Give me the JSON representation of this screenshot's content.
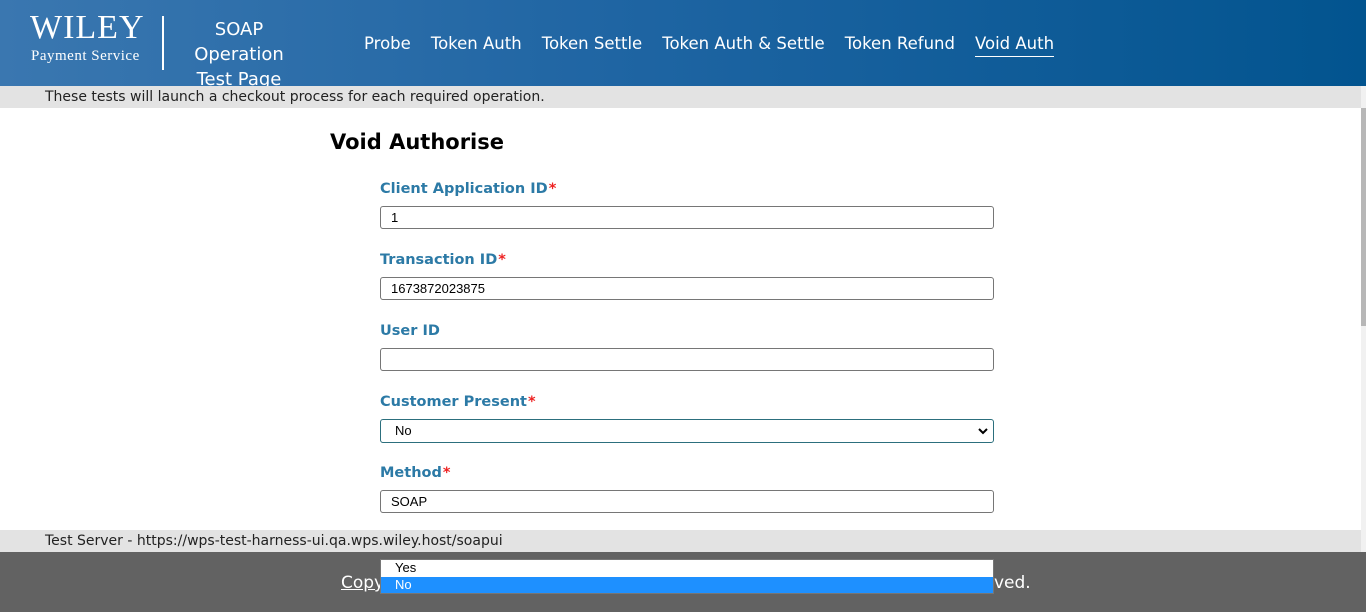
{
  "header": {
    "logo_text": "WILEY",
    "logo_subtitle": "Payment Service",
    "app_title_line1": "SOAP Operation",
    "app_title_line2": "Test Page",
    "nav": [
      {
        "label": "Probe"
      },
      {
        "label": "Token Auth"
      },
      {
        "label": "Token Settle"
      },
      {
        "label": "Token Auth & Settle"
      },
      {
        "label": "Token Refund"
      },
      {
        "label": "Void Auth",
        "active": true
      }
    ]
  },
  "info_bar_text": "These tests will launch a checkout process for each required operation.",
  "form": {
    "title": "Void Authorise",
    "required_marker": "*",
    "fields": [
      {
        "label": "Client Application ID",
        "required": true,
        "value": "1"
      },
      {
        "label": "Transaction ID",
        "required": true,
        "value": "1673872023875"
      },
      {
        "label": "User ID",
        "required": false,
        "value": ""
      },
      {
        "label": "Customer Present",
        "required": true,
        "value": "No"
      },
      {
        "label": "Method",
        "required": true,
        "value": "SOAP"
      }
    ]
  },
  "dropdown_options": [
    "Yes",
    "No"
  ],
  "selected_option": "No",
  "server_text": "Test Server - https://wps-test-harness-ui.qa.wps.wiley.host/soapui",
  "footer": {
    "left_text": "Copy",
    "right_text": "ved."
  },
  "colors": {
    "label_color": "#2c7aa6",
    "required_color": "#e22222",
    "header_gradient_start": "#3a77b0",
    "header_gradient_end": "#02548f",
    "footer_bg": "#626262",
    "highlight": "#1e90ff"
  }
}
